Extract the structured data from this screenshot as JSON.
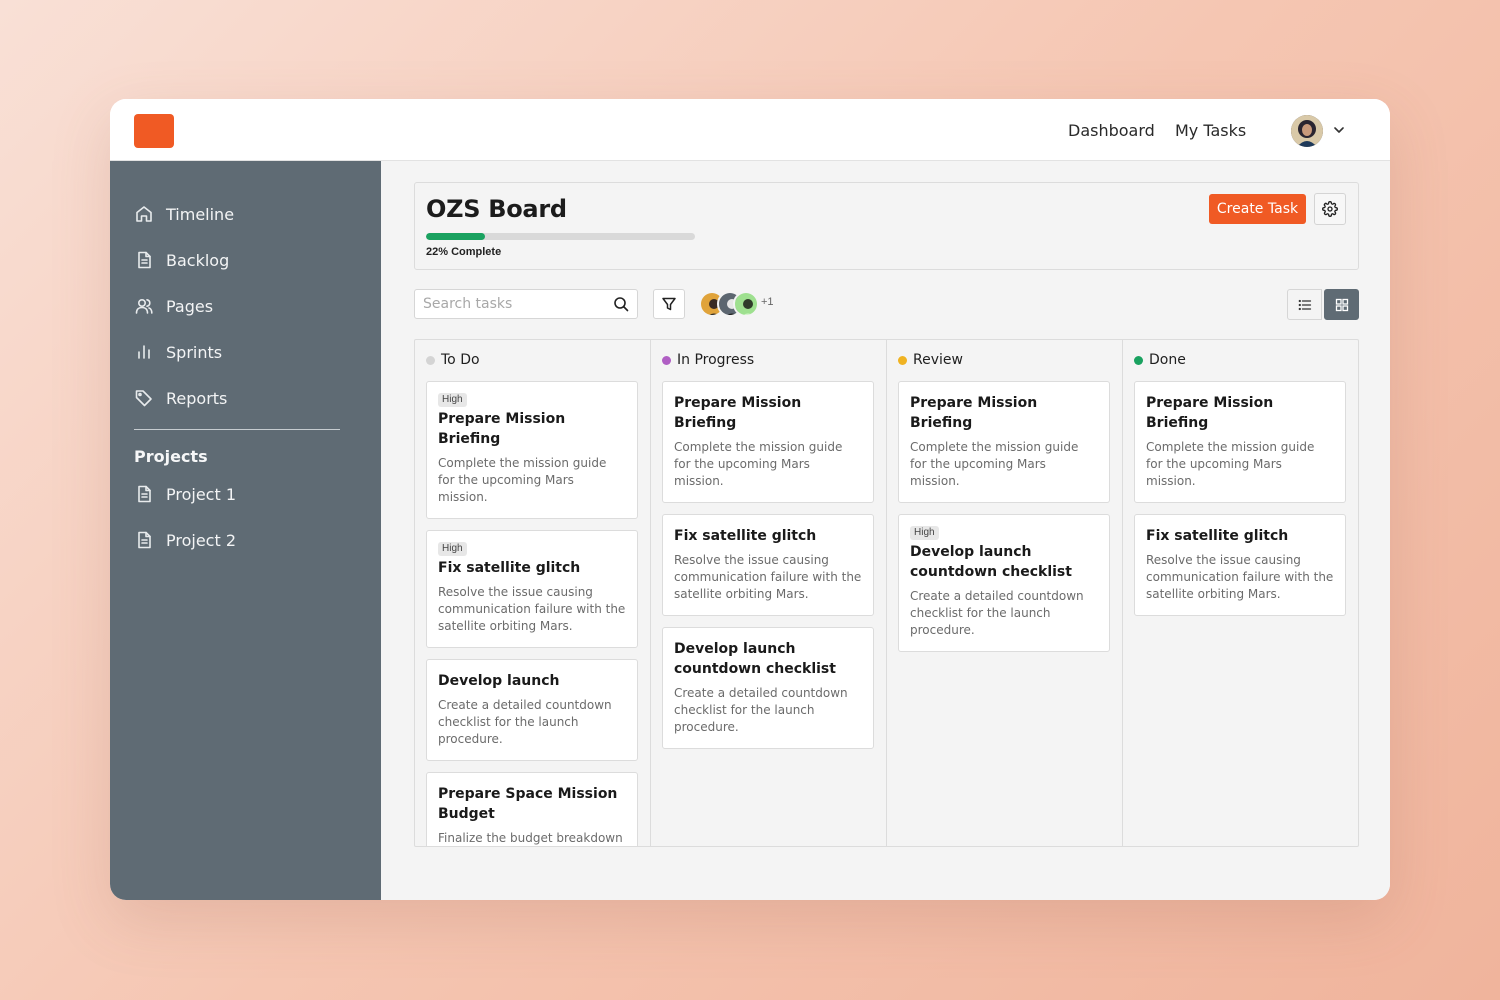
{
  "topbar": {
    "nav": [
      "Dashboard",
      "My Tasks"
    ]
  },
  "sidebar": {
    "items": [
      {
        "label": "Timeline",
        "icon": "home-icon"
      },
      {
        "label": "Backlog",
        "icon": "document-icon"
      },
      {
        "label": "Pages",
        "icon": "users-icon"
      },
      {
        "label": "Sprints",
        "icon": "bar-chart-icon"
      },
      {
        "label": "Reports",
        "icon": "tag-icon"
      }
    ],
    "projects_heading": "Projects",
    "projects": [
      {
        "label": "Project 1",
        "icon": "document-icon"
      },
      {
        "label": "Project 2",
        "icon": "document-icon"
      }
    ]
  },
  "board": {
    "title": "OZS Board",
    "progress_percent": 22,
    "progress_text": "22% Complete",
    "create_label": "Create Task",
    "search_placeholder": "Search tasks",
    "members_more": "+1",
    "accent_color": "#f05a24",
    "progress_color": "#1aa260"
  },
  "columns": [
    {
      "name": "To Do",
      "color": "#d4d4d4",
      "cards": [
        {
          "badge": "High",
          "title": "Prepare Mission Briefing",
          "desc": "Complete the mission guide for the upcoming Mars mission."
        },
        {
          "badge": "High",
          "title": "Fix satellite glitch",
          "desc": "Resolve the issue causing communication failure with the satellite orbiting Mars."
        },
        {
          "badge": "",
          "title": "Develop launch",
          "desc": "Create a detailed countdown checklist for the launch procedure."
        },
        {
          "badge": "",
          "title": "Prepare Space Mission Budget",
          "desc": "Finalize the budget breakdown for the Mars mission."
        }
      ]
    },
    {
      "name": "In Progress",
      "color": "#b05fc4",
      "cards": [
        {
          "badge": "",
          "title": "Prepare Mission Briefing",
          "desc": "Complete the mission guide for the upcoming Mars mission."
        },
        {
          "badge": "",
          "title": "Fix satellite glitch",
          "desc": "Resolve the issue causing communication failure with the satellite orbiting Mars."
        },
        {
          "badge": "",
          "title": "Develop launch countdown checklist",
          "desc": "Create a detailed countdown checklist for the launch procedure."
        }
      ]
    },
    {
      "name": "Review",
      "color": "#f0b322",
      "cards": [
        {
          "badge": "",
          "title": "Prepare Mission Briefing",
          "desc": "Complete the mission guide for the upcoming Mars mission."
        },
        {
          "badge": "High",
          "title": "Develop launch countdown checklist",
          "desc": "Create a detailed countdown checklist for the launch procedure."
        }
      ]
    },
    {
      "name": "Done",
      "color": "#1aa260",
      "cards": [
        {
          "badge": "",
          "title": "Prepare Mission Briefing",
          "desc": "Complete the mission guide for the upcoming Mars mission."
        },
        {
          "badge": "",
          "title": "Fix satellite glitch",
          "desc": "Resolve the issue causing communication failure with the satellite orbiting Mars."
        }
      ]
    }
  ]
}
